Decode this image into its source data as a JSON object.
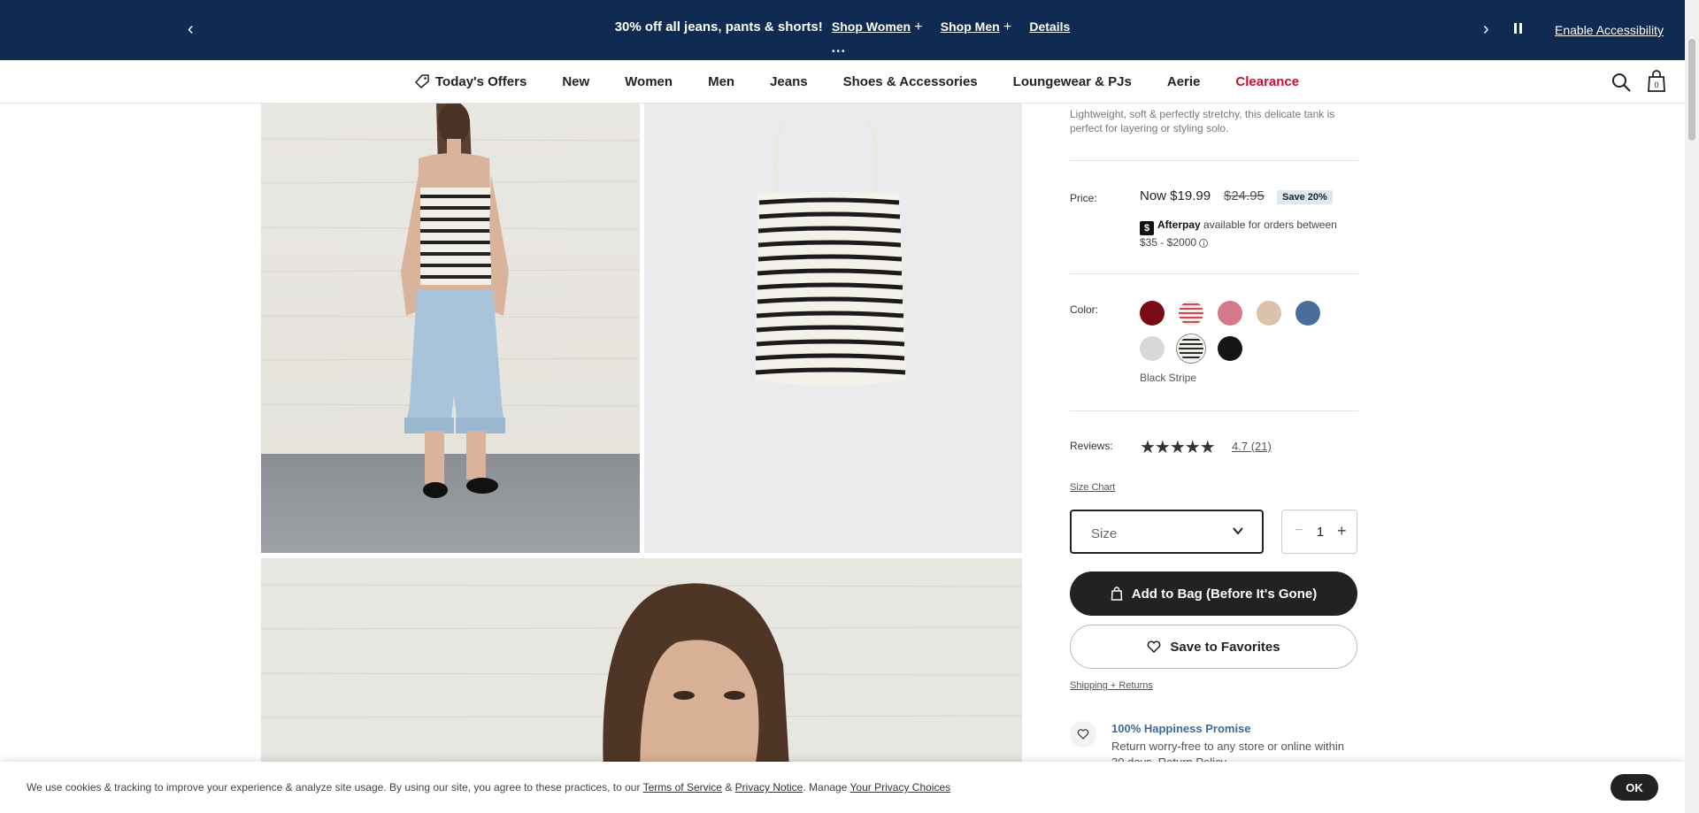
{
  "promo": {
    "message": "30% off all jeans, pants & shorts!",
    "shop_women": "Shop Women",
    "shop_men": "Shop Men",
    "details": "Details",
    "accessibility": "Enable Accessibility"
  },
  "nav": {
    "items": [
      "Today's Offers",
      "New",
      "Women",
      "Men",
      "Jeans",
      "Shoes & Accessories",
      "Loungewear & PJs",
      "Aerie",
      "Clearance"
    ],
    "bag_count": "0"
  },
  "product": {
    "description": "Lightweight, soft & perfectly stretchy, this delicate tank is perfect for layering or styling solo.",
    "price_label": "Price:",
    "price_now": "Now $19.99",
    "price_was": "$24.95",
    "save_badge": "Save 20%",
    "afterpay_name": "Afterpay",
    "afterpay_text": "available for orders between $35 - $2000",
    "color_label": "Color:",
    "colors": [
      {
        "name": "burgundy",
        "hex": "#7a0a16"
      },
      {
        "name": "red-stripe",
        "hex": "#c94a55"
      },
      {
        "name": "pink",
        "hex": "#d4788a"
      },
      {
        "name": "tan",
        "hex": "#dbc2aa"
      },
      {
        "name": "blue",
        "hex": "#4b6d9b"
      },
      {
        "name": "light-grey",
        "hex": "#d8d8d8"
      },
      {
        "name": "black-stripe",
        "hex": "#2a2a2a"
      },
      {
        "name": "black",
        "hex": "#151515"
      }
    ],
    "selected_color": "Black Stripe",
    "reviews_label": "Reviews:",
    "rating": "4.7",
    "review_count": "(21)",
    "size_chart": "Size Chart",
    "size_placeholder": "Size",
    "quantity": "1",
    "add_to_bag": "Add to Bag (Before It's Gone)",
    "save_favorites": "Save to Favorites",
    "shipping": "Shipping + Returns",
    "happiness_title": "100% Happiness Promise",
    "happiness_text": "Return worry-free to any store or online within 30 days. Return Policy"
  },
  "cookie": {
    "text_start": "We use cookies & tracking to improve your experience & analyze site usage. By using our site, you agree to these practices, to our",
    "terms": "Terms of Service",
    "amp": "&",
    "privacy": "Privacy Notice",
    "manage": ". Manage",
    "choices": "Your Privacy Choices",
    "ok": "OK"
  }
}
